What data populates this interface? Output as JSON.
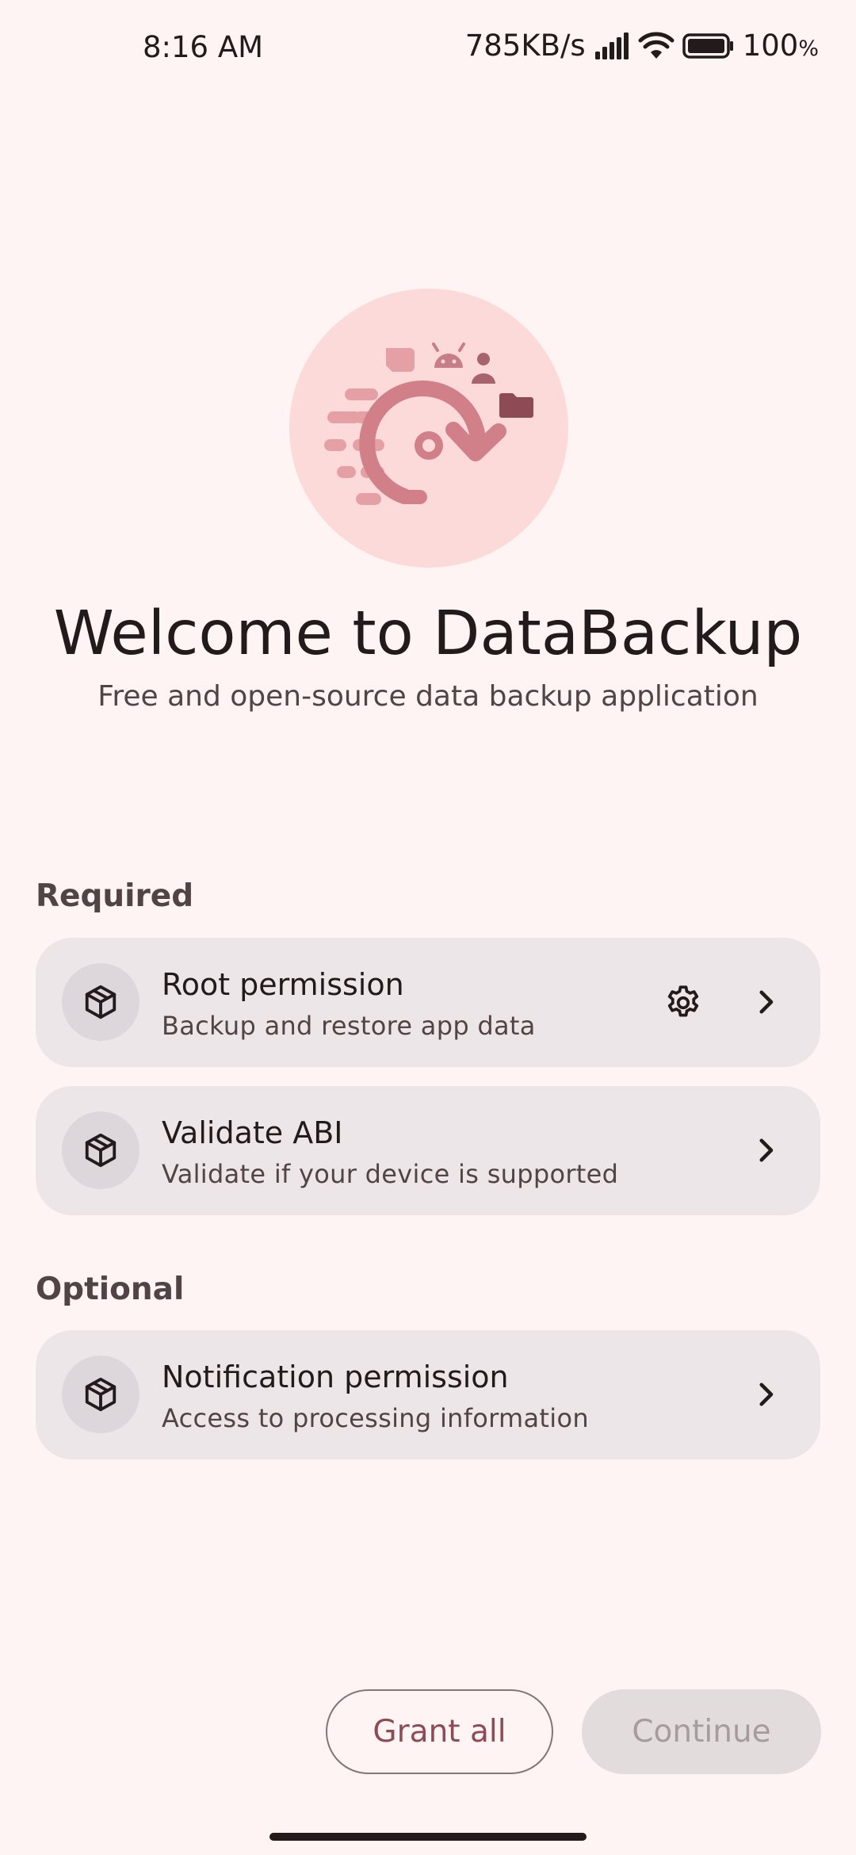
{
  "status_bar": {
    "time": "8:16 AM",
    "speed": "785KB/s",
    "battery": "100",
    "battery_unit": "%"
  },
  "hero": {
    "icon": "backup-restore-illustration"
  },
  "title": "Welcome to DataBackup",
  "subtitle": "Free and open-source data backup application",
  "sections": {
    "required": {
      "label": "Required",
      "items": [
        {
          "title": "Root permission",
          "subtitle": "Backup and restore app data",
          "icon": "package-icon",
          "has_settings": true
        },
        {
          "title": "Validate ABI",
          "subtitle": "Validate if your device is supported",
          "icon": "package-icon",
          "has_settings": false
        }
      ]
    },
    "optional": {
      "label": "Optional",
      "items": [
        {
          "title": "Notification permission",
          "subtitle": "Access to processing information",
          "icon": "package-icon",
          "has_settings": false
        }
      ]
    }
  },
  "buttons": {
    "grant_all": "Grant all",
    "continue": "Continue"
  },
  "colors": {
    "background": "#FDF4F3",
    "card": "#EDE6E9",
    "accent": "#8D4C55",
    "hero_bg": "#FCDADA"
  }
}
